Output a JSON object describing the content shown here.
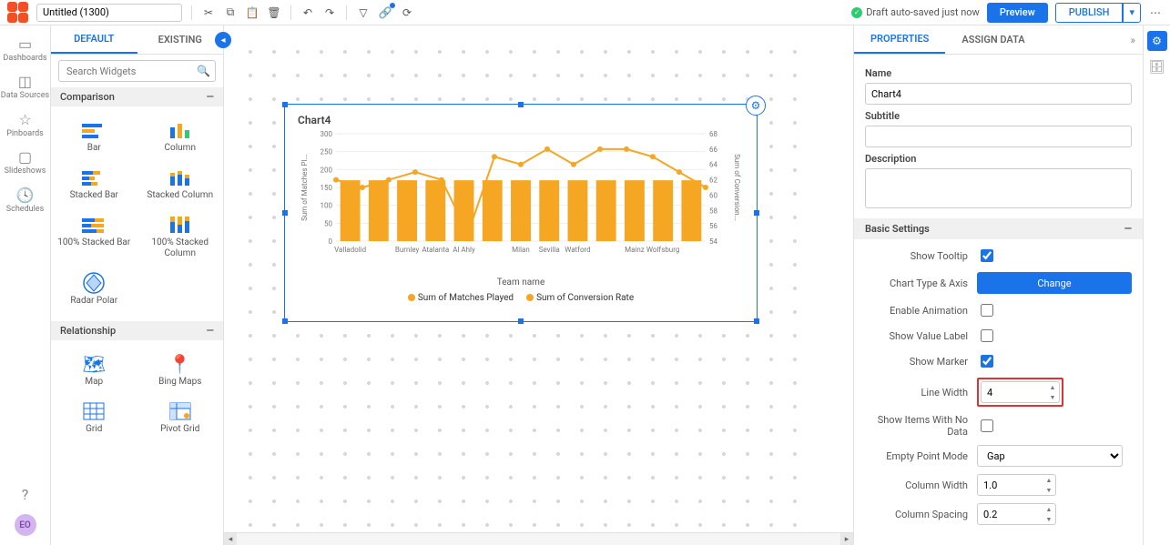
{
  "header": {
    "title_value": "Untitled (1300)",
    "save_status": "Draft auto-saved just now",
    "preview_label": "Preview",
    "publish_label": "PUBLISH"
  },
  "leftnav": {
    "items": [
      {
        "icon": "dashboards",
        "label": "Dashboards"
      },
      {
        "icon": "datasources",
        "label": "Data Sources"
      },
      {
        "icon": "pinboards",
        "label": "Pinboards"
      },
      {
        "icon": "slideshows",
        "label": "Slideshows"
      },
      {
        "icon": "schedules",
        "label": "Schedules"
      }
    ],
    "avatar": "EO"
  },
  "widget_sidebar": {
    "tabs": {
      "default": "DEFAULT",
      "existing": "EXISTING"
    },
    "search_placeholder": "Search Widgets",
    "section_comparison": "Comparison",
    "section_relationship": "Relationship",
    "widgets_comparison": [
      {
        "label": "Bar"
      },
      {
        "label": "Column"
      },
      {
        "label": "Stacked Bar"
      },
      {
        "label": "Stacked Column"
      },
      {
        "label": "100% Stacked Bar"
      },
      {
        "label": "100% Stacked Column"
      },
      {
        "label": "Radar Polar"
      }
    ],
    "widgets_relationship": [
      {
        "label": "Map"
      },
      {
        "label": "Bing Maps"
      },
      {
        "label": "Grid"
      },
      {
        "label": "Pivot Grid"
      }
    ]
  },
  "chart_data": {
    "type": "bar",
    "title": "Chart4",
    "xlabel": "Team name",
    "ylabel": "Sum of Matches Pl...",
    "y2label": "Sum of Conversion...",
    "categories": [
      "Valladolid",
      "",
      "Burnley",
      "Atalanta",
      "Al Ahly",
      "",
      "Milan",
      "Sevilla",
      "Watford",
      "",
      "Mainz",
      "Wolfsburg",
      ""
    ],
    "series": [
      {
        "name": "Sum of Matches Played",
        "type": "bar",
        "color": "#f5a623",
        "values": [
          170,
          170,
          170,
          170,
          170,
          170,
          170,
          170,
          170,
          170,
          170,
          170,
          170
        ]
      },
      {
        "name": "Sum of Conversion Rate",
        "type": "line",
        "color": "#f5a623",
        "values": [
          62,
          61,
          62,
          63,
          62,
          55,
          65,
          64,
          66,
          64,
          66,
          66,
          65,
          63,
          61
        ]
      }
    ],
    "ylim": [
      0,
      300
    ],
    "yticks": [
      0,
      50,
      100,
      150,
      200,
      250,
      300
    ],
    "y2lim": [
      54,
      68
    ],
    "y2ticks": [
      54,
      56,
      58,
      60,
      62,
      64,
      66,
      68
    ]
  },
  "properties": {
    "tabs": {
      "properties": "PROPERTIES",
      "assign": "ASSIGN DATA"
    },
    "labels": {
      "name": "Name",
      "subtitle": "Subtitle",
      "description": "Description",
      "basic_settings": "Basic Settings",
      "show_tooltip": "Show Tooltip",
      "chart_type_axis": "Chart Type & Axis",
      "change": "Change",
      "enable_animation": "Enable Animation",
      "show_value_label": "Show Value Label",
      "show_marker": "Show Marker",
      "line_width": "Line Width",
      "show_items_no_data": "Show Items With No Data",
      "empty_point_mode": "Empty Point Mode",
      "column_width": "Column Width",
      "column_spacing": "Column Spacing"
    },
    "values": {
      "name": "Chart4",
      "subtitle": "",
      "description": "",
      "show_tooltip": true,
      "enable_animation": false,
      "show_value_label": false,
      "show_marker": true,
      "line_width": "4",
      "show_items_no_data": false,
      "empty_point_mode": "Gap",
      "column_width": "1.0",
      "column_spacing": "0.2"
    }
  }
}
